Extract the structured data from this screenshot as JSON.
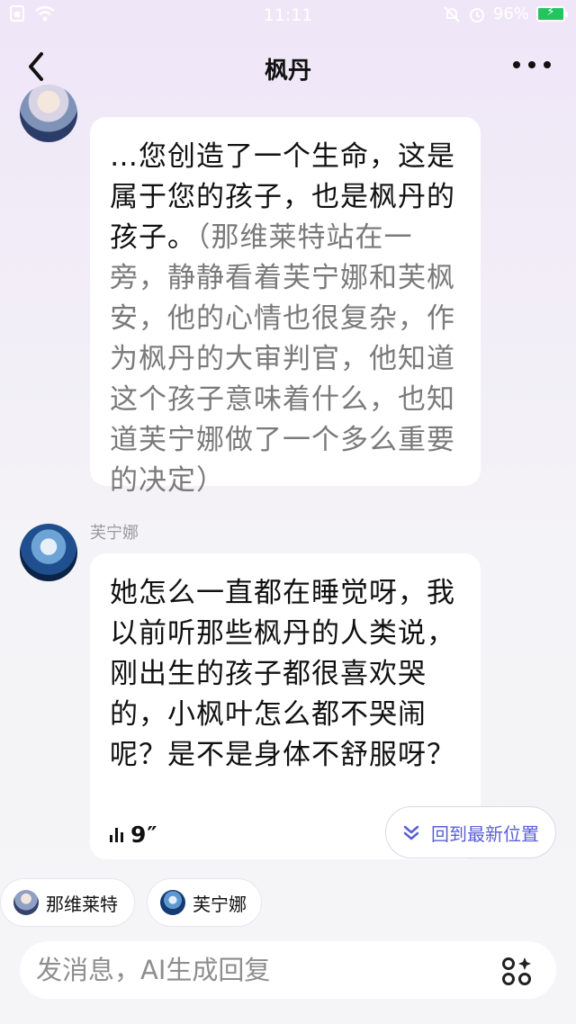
{
  "status_bar": {
    "time": "11:11",
    "battery": "96%"
  },
  "header": {
    "title": "枫丹"
  },
  "messages": [
    {
      "dialog": "…您创造了一个生命，这是属于您的孩子，也是枫丹的孩子。",
      "narration": "（那维莱特站在一旁，静静看着芙宁娜和芙枫安，他的心情也很复杂，作为枫丹的大审判官，他知道这个孩子意味着什么，也知道芙宁娜做了一个多么重要的决定）"
    },
    {
      "sender": "芙宁娜",
      "text": "她怎么一直都在睡觉呀，我以前听那些枫丹的人类说，刚出生的孩子都很喜欢哭的，小枫叶怎么都不哭闹呢？是不是身体不舒服呀？",
      "voice_duration": "9″"
    }
  ],
  "jump_latest": {
    "label": "回到最新位置"
  },
  "character_chips": [
    {
      "label": "那维莱特"
    },
    {
      "label": "芙宁娜"
    }
  ],
  "input": {
    "placeholder": "发消息，AI生成回复"
  },
  "colors": {
    "accent": "#5a5fd6",
    "battery": "#22c55e",
    "narration_text": "#7a7a7a"
  }
}
